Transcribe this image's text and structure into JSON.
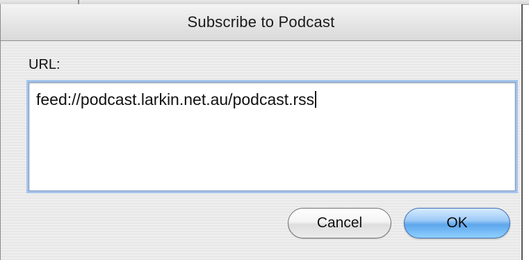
{
  "dialog": {
    "title": "Subscribe to Podcast",
    "url_label": "URL:",
    "url_value": "feed://podcast.larkin.net.au/podcast.rss"
  },
  "buttons": {
    "cancel_label": "Cancel",
    "ok_label": "OK"
  },
  "colors": {
    "default_button": "#5ea6ec",
    "focus_ring": "#a7c4ea"
  }
}
